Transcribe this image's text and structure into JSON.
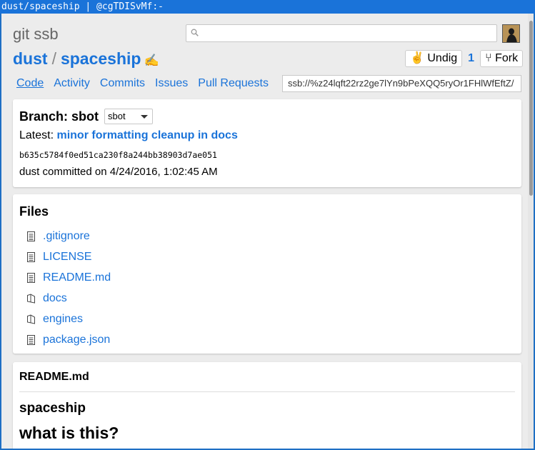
{
  "window": {
    "title": "dust/spaceship | @cgTDISvMf:-"
  },
  "header": {
    "app_name": "git ssb",
    "search_placeholder": ""
  },
  "repo": {
    "owner": "dust",
    "separator": "/",
    "name": "spaceship"
  },
  "actions": {
    "undig_label": "✌ Undig",
    "dig_count": "1",
    "fork_label": "⑂ Fork",
    "plus_label": "+"
  },
  "nav": {
    "tabs": [
      {
        "label": "Code",
        "active": true
      },
      {
        "label": "Activity"
      },
      {
        "label": "Commits"
      },
      {
        "label": "Issues"
      },
      {
        "label": "Pull Requests"
      }
    ],
    "ssb_url": "ssb://%z24lqft22rz2ge7lYn9bPeXQQ5ryOr1FHlWfEftZ/"
  },
  "branch": {
    "label": "Branch: sbot",
    "selected": "sbot",
    "latest_prefix": "Latest: ",
    "latest_message": "minor formatting cleanup in docs",
    "commit_hash": "b635c5784f0ed51ca230f8a244bb38903d7ae051",
    "committed_text": "dust committed on 4/24/2016, 1:02:45 AM"
  },
  "files": {
    "title": "Files",
    "items": [
      {
        "name": ".gitignore",
        "icon": "file-icon"
      },
      {
        "name": "LICENSE",
        "icon": "file-icon"
      },
      {
        "name": "README.md",
        "icon": "file-icon"
      },
      {
        "name": "docs",
        "icon": "folder-icon"
      },
      {
        "name": "engines",
        "icon": "folder-icon"
      },
      {
        "name": "package.json",
        "icon": "file-icon"
      }
    ]
  },
  "readme": {
    "title": "README.md",
    "h3": "spaceship",
    "h2": "what is this?"
  },
  "colors": {
    "accent": "#1a73d9",
    "titlebar": "#1a73d9",
    "background": "#ececec"
  }
}
